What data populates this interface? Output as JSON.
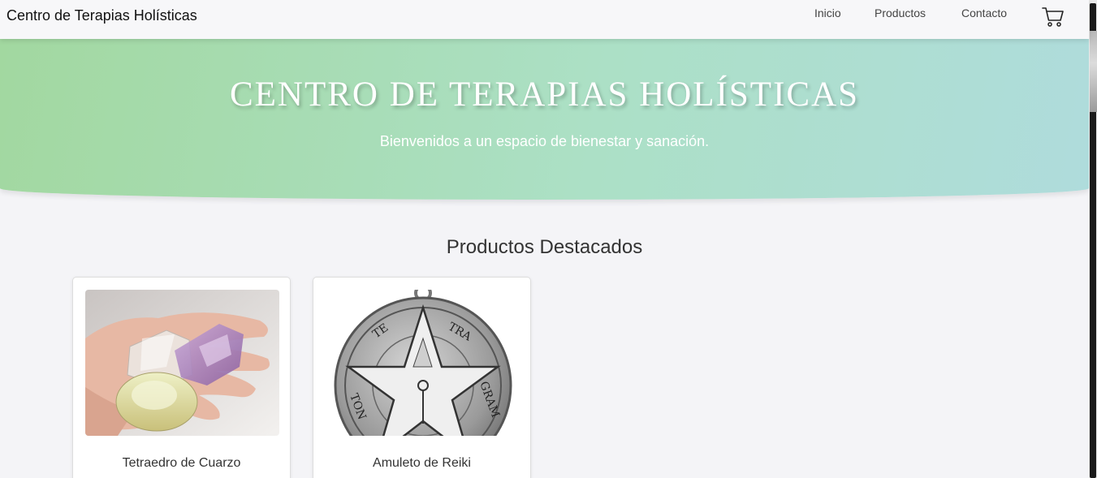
{
  "navbar": {
    "brand": "Centro de Terapias Holísticas",
    "links": [
      "Inicio",
      "Productos",
      "Contacto"
    ],
    "cart_icon": "shopping-cart-icon"
  },
  "hero": {
    "title": "CENTRO DE TERAPIAS HOLÍSTICAS",
    "subtitle": "Bienvenidos a un espacio de bienestar y sanación."
  },
  "products": {
    "title": "Productos Destacados",
    "items": [
      {
        "name": "Tetraedro de Cuarzo"
      },
      {
        "name": "Amuleto de Reiki"
      }
    ]
  },
  "colors": {
    "hero_start": "#a2d8a0",
    "hero_end": "#afdcdc",
    "background": "#f4f4f7"
  }
}
